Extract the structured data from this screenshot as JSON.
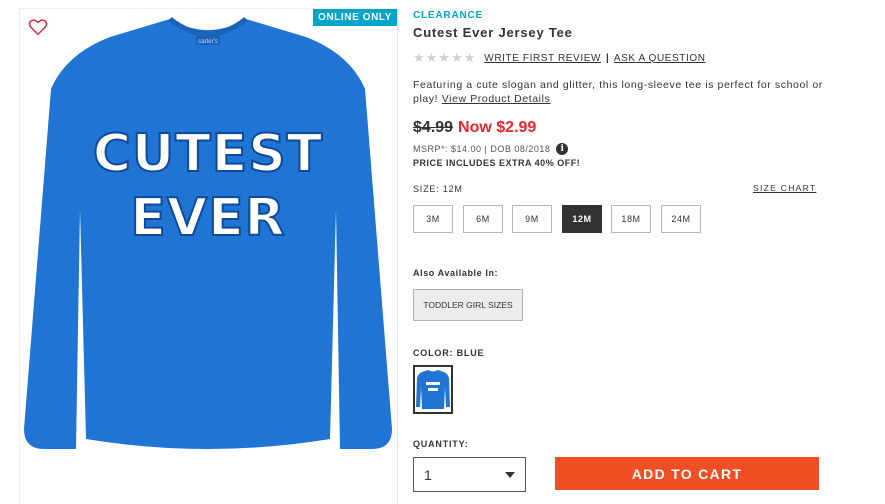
{
  "product_image": {
    "badge": "ONLINE ONLY",
    "shirt_slogan_line1": "CUTEST",
    "shirt_slogan_line2": "EVER",
    "neck_tag": "carter's",
    "favorite_icon": "heart-outline-icon",
    "shirt_color": "#1f74d4"
  },
  "product": {
    "eyebrow": "CLEARANCE",
    "title": "Cutest Ever Jersey Tee",
    "rating": {
      "stars_filled": 0,
      "stars_total": 5,
      "stars_glyphs": "★★★★★",
      "write_review": "WRITE FIRST REVIEW",
      "separator": "|",
      "ask_question": "ASK A QUESTION"
    },
    "description": "Featuring a cute slogan and glitter, this long-sleeve tee is perfect for school or play!",
    "description_link": "View Product Details",
    "price": {
      "old": "$4.99",
      "now": "Now $2.99",
      "msrp_line": "MSRP*: $14.00 | DOB 08/2018",
      "info_icon": "info-icon",
      "promo": "PRICE INCLUDES EXTRA 40% OFF!"
    },
    "size": {
      "label": "SIZE: 12M",
      "chart_link": "SIZE CHART",
      "options": [
        "3M",
        "6M",
        "9M",
        "12M",
        "18M",
        "24M"
      ],
      "selected": "12M"
    },
    "also_available": {
      "label": "Also Available In:",
      "option": "TODDLER GIRL SIZES"
    },
    "color": {
      "label": "COLOR: BLUE",
      "swatch_color": "#1f74d4"
    },
    "quantity": {
      "label": "QUANTITY:",
      "value": "1"
    },
    "add_to_cart": "ADD TO CART",
    "accent_colors": {
      "badge": "#00a5c7",
      "sale_price": "#e8262d",
      "cart_button": "#f04e23"
    }
  }
}
